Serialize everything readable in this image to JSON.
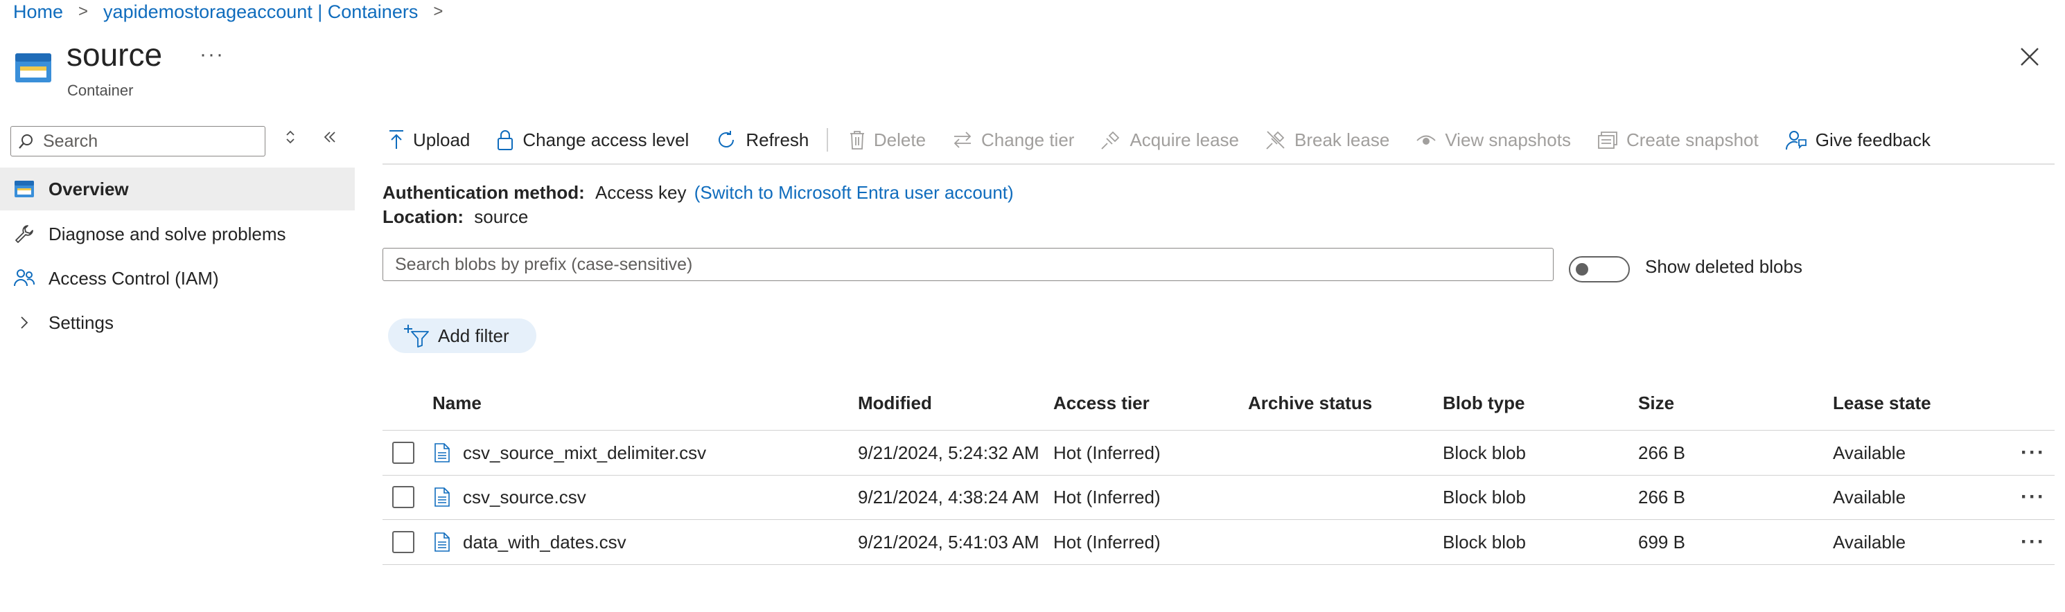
{
  "breadcrumb": {
    "items": [
      "Home",
      "yapidemostorageaccount | Containers"
    ],
    "separator": ">"
  },
  "header": {
    "title": "source",
    "subtitle": "Container",
    "more": "···"
  },
  "sidebar": {
    "search_placeholder": "Search",
    "items": [
      {
        "label": "Overview",
        "icon": "container-icon",
        "active": true
      },
      {
        "label": "Diagnose and solve problems",
        "icon": "wrench-icon"
      },
      {
        "label": "Access Control (IAM)",
        "icon": "people-icon"
      },
      {
        "label": "Settings",
        "icon": "chevron-right-icon"
      }
    ]
  },
  "toolbar": {
    "upload": "Upload",
    "change_access": "Change access level",
    "refresh": "Refresh",
    "delete": "Delete",
    "change_tier": "Change tier",
    "acquire_lease": "Acquire lease",
    "break_lease": "Break lease",
    "view_snapshots": "View snapshots",
    "create_snapshot": "Create snapshot",
    "feedback": "Give feedback"
  },
  "info": {
    "auth_label": "Authentication method:",
    "auth_value": "Access key",
    "auth_link": "(Switch to Microsoft Entra user account)",
    "location_label": "Location:",
    "location_value": "source"
  },
  "blob_search": {
    "placeholder": "Search blobs by prefix (case-sensitive)"
  },
  "show_deleted": {
    "label": "Show deleted blobs",
    "on": false
  },
  "add_filter": "Add filter",
  "table": {
    "headers": [
      "Name",
      "Modified",
      "Access tier",
      "Archive status",
      "Blob type",
      "Size",
      "Lease state"
    ],
    "rows": [
      {
        "name": "csv_source_mixt_delimiter.csv",
        "modified": "9/21/2024, 5:24:32 AM",
        "tier": "Hot (Inferred)",
        "archive": "",
        "type": "Block blob",
        "size": "266 B",
        "lease": "Available"
      },
      {
        "name": "csv_source.csv",
        "modified": "9/21/2024, 4:38:24 AM",
        "tier": "Hot (Inferred)",
        "archive": "",
        "type": "Block blob",
        "size": "266 B",
        "lease": "Available"
      },
      {
        "name": "data_with_dates.csv",
        "modified": "9/21/2024, 5:41:03 AM",
        "tier": "Hot (Inferred)",
        "archive": "",
        "type": "Block blob",
        "size": "699 B",
        "lease": "Available"
      }
    ],
    "row_more": "···"
  },
  "colors": {
    "accent": "#0f6cbd",
    "disabled": "#a19f9d",
    "selected_bg": "#ededed"
  }
}
